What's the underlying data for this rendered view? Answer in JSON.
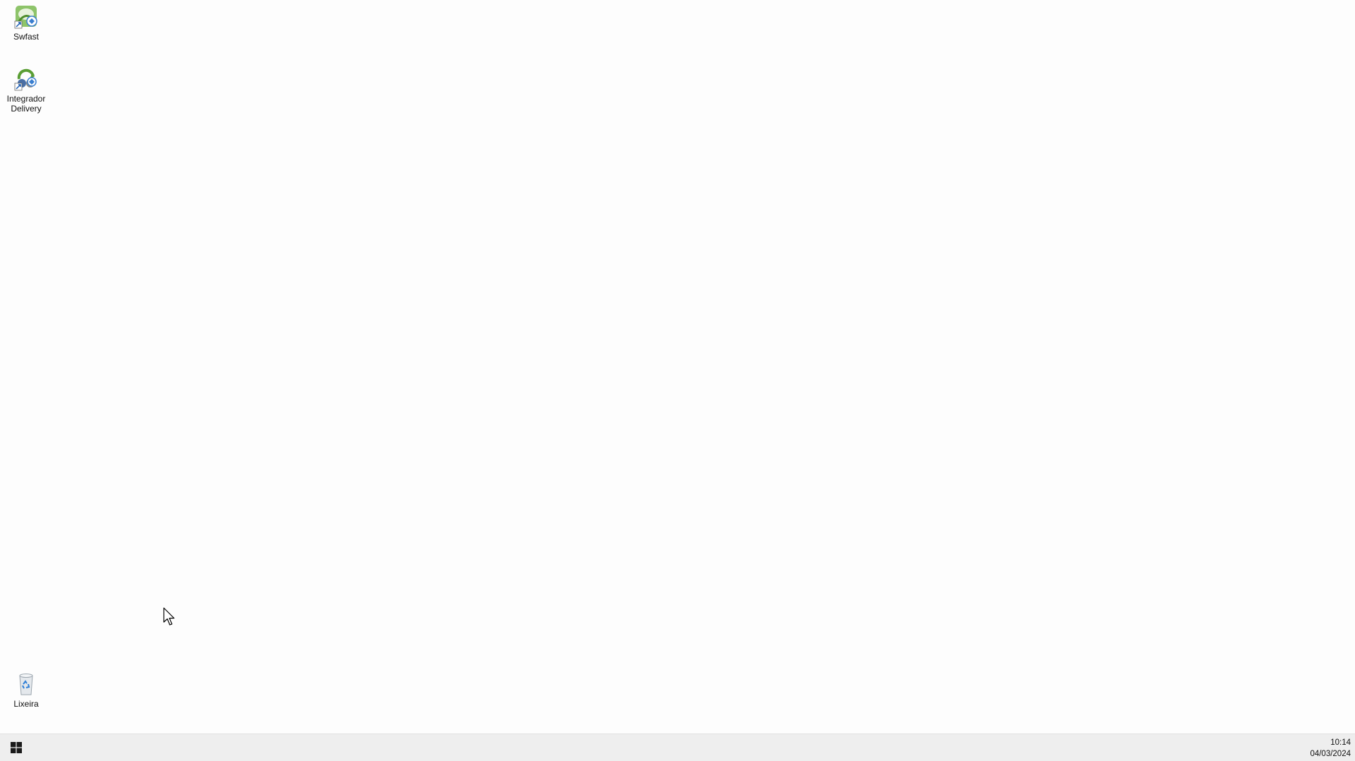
{
  "desktop": {
    "icons": [
      {
        "label": "Swfast",
        "icon": "swfast-app-icon"
      },
      {
        "label": "Integrador\nDelivery",
        "icon": "integrador-delivery-app-icon"
      },
      {
        "label": "Lixeira",
        "icon": "recycle-bin-icon"
      }
    ],
    "background_color": "#fdfdfd"
  },
  "taskbar": {
    "start_icon": "windows-logo-icon",
    "clock": {
      "time": "10:14",
      "date": "04/03/2024"
    },
    "background_color": "#eeeeee"
  }
}
